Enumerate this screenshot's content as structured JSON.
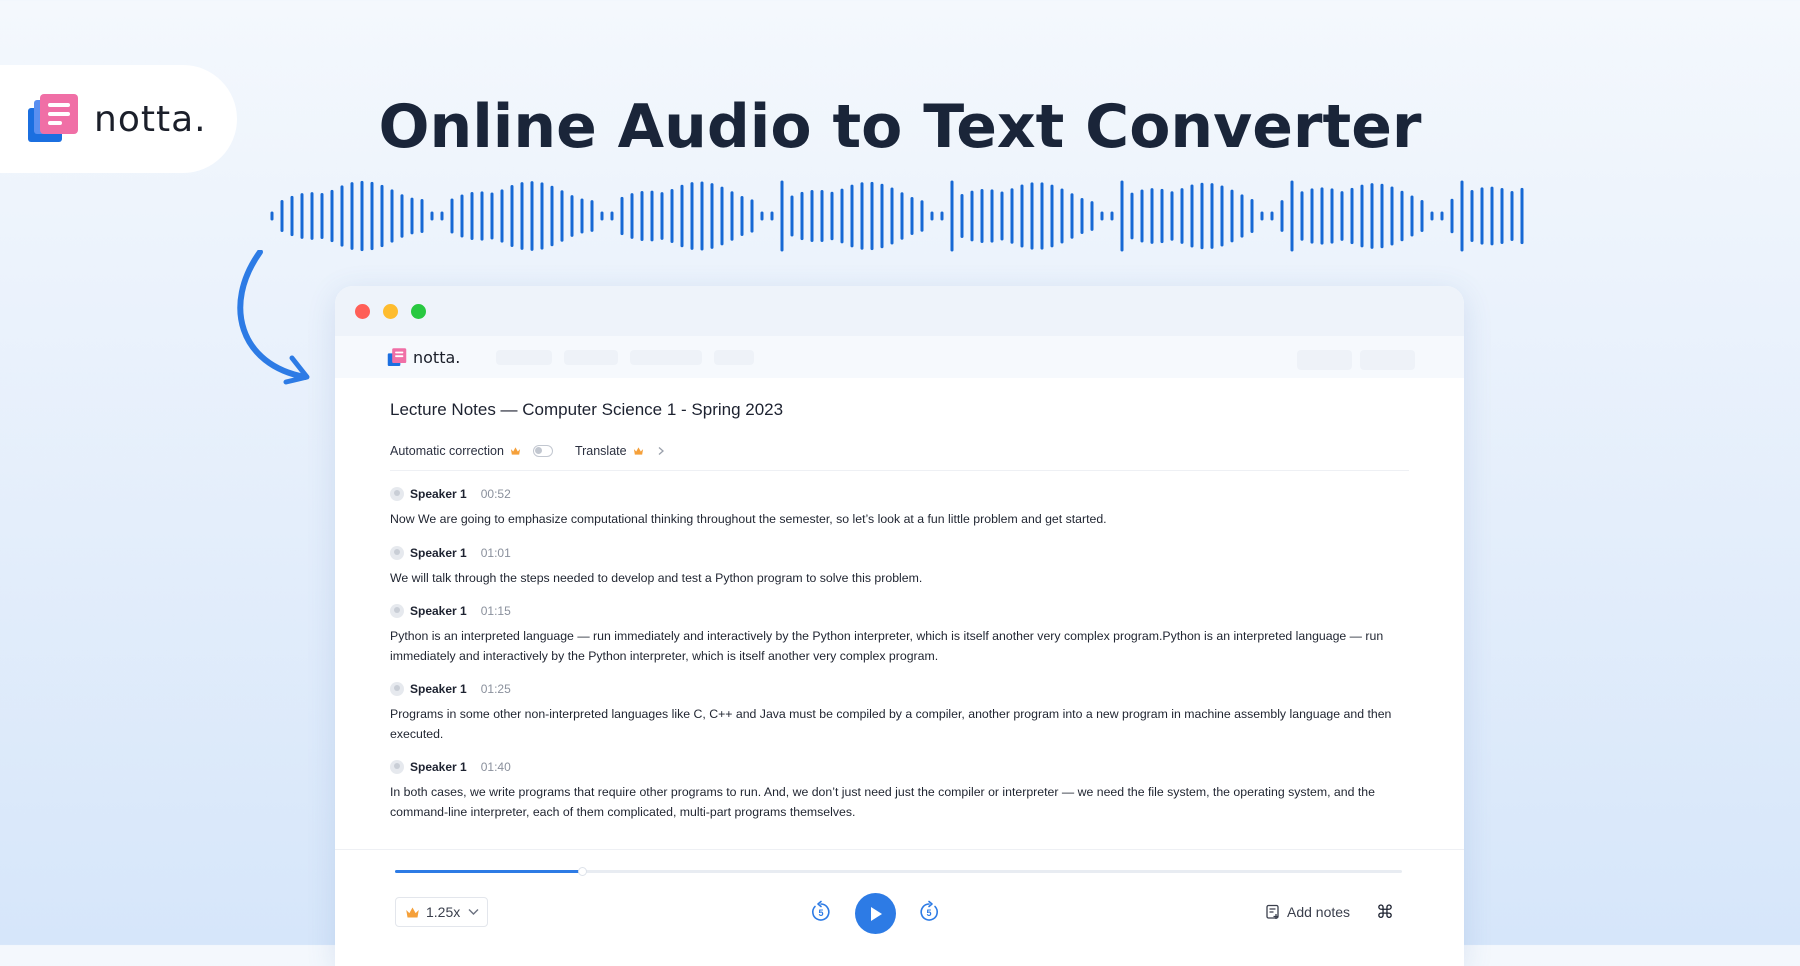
{
  "brand": {
    "name": "notta.",
    "colors": {
      "accent": "#2d7be5",
      "wave": "#1668d4",
      "headline": "#1a2539"
    }
  },
  "headline": "Online Audio to Text Converter",
  "window": {
    "controls": [
      "close",
      "minimize",
      "maximize"
    ],
    "app_logo": "notta."
  },
  "document": {
    "title": "Lecture Notes — Computer Science 1 - Spring 2023",
    "toolbar": {
      "auto_correction_label": "Automatic correction",
      "auto_correction_on": false,
      "translate_label": "Translate"
    },
    "segments": [
      {
        "speaker": "Speaker 1",
        "time": "00:52",
        "text": "Now We are going to emphasize computational thinking throughout the semester, so let’s look at a fun little problem and get started."
      },
      {
        "speaker": "Speaker 1",
        "time": "01:01",
        "text": "We will talk through the steps needed to develop and test a Python program to solve this problem."
      },
      {
        "speaker": "Speaker 1",
        "time": "01:15",
        "text": "Python is an interpreted language — run immediately and interactively by the Python interpreter, which is itself another very complex program.Python is an interpreted language — run immediately and interactively by the Python interpreter, which is itself another very complex program."
      },
      {
        "speaker": "Speaker 1",
        "time": "01:25",
        "text": "Programs in some other non-interpreted languages like C, C++ and Java must be compiled by a compiler, another program into a new program in machine assembly language and then executed."
      },
      {
        "speaker": "Speaker 1",
        "time": "01:40",
        "text": "In both cases, we write programs that require other programs to run. And, we don’t just need just the compiler or interpreter — we need the file system, the operating system, and the command-line interpreter, each of them complicated, multi-part programs themselves."
      }
    ]
  },
  "player": {
    "progress": 0.186,
    "speed": "1.25x",
    "skip_back_seconds": "5",
    "skip_forward_seconds": "5",
    "add_notes_label": "Add notes",
    "shortcut_glyph": "⌘",
    "icons": [
      "crown-icon",
      "chevron-down-icon",
      "rewind-5-icon",
      "play-icon",
      "forward-5-icon",
      "add-notes-icon",
      "command-icon"
    ]
  }
}
